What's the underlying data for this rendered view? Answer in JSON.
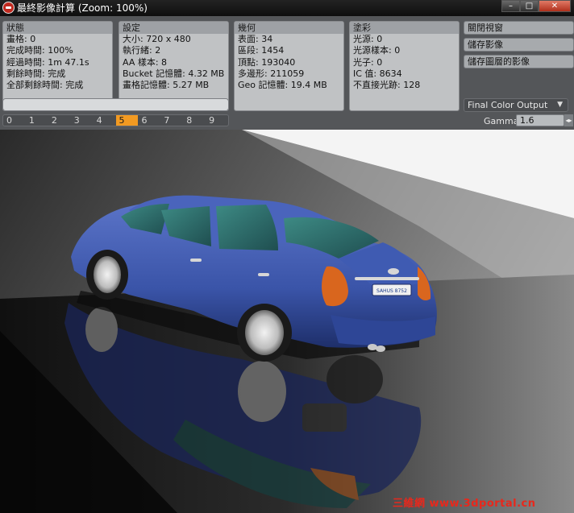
{
  "window": {
    "title": "最終影像計算 (Zoom: 100%)"
  },
  "status": {
    "header": "狀態",
    "rows": [
      "畫格: 0",
      "完成時間: 100%",
      "經過時間: 1m 47.1s",
      "剩餘時間: 完成",
      "全部剩餘時間: 完成"
    ]
  },
  "settings": {
    "header": "設定",
    "rows": [
      "大小: 720 x 480",
      "執行緒: 2",
      "AA 樣本: 8",
      "Bucket 記憶體: 4.32 MB",
      "畫格記憶體: 5.27 MB"
    ]
  },
  "geometry": {
    "header": "幾何",
    "rows": [
      "表面: 34",
      "區段: 1454",
      "頂點: 193040",
      "多邊形: 211059",
      "Geo 記憶體: 19.4 MB"
    ]
  },
  "shading": {
    "header": "塗彩",
    "rows": [
      "光源: 0",
      "光源樣本: 0",
      "光子: 0",
      "IC 值: 8634",
      "不直接光跡: 128"
    ]
  },
  "actions": {
    "close_window": "關閉視窗",
    "save_image": "儲存影像",
    "save_layered_image": "儲存圖層的影像"
  },
  "progress": {
    "fraction": 1.0
  },
  "buffers": {
    "items": [
      "0",
      "1",
      "2",
      "3",
      "4",
      "5",
      "6",
      "7",
      "8",
      "9"
    ],
    "active_index": 5
  },
  "output": {
    "selected": "Final Color Output"
  },
  "gamma": {
    "label": "Gamma",
    "value": "1.6"
  },
  "render": {
    "plate_text": "SAHUS 8752",
    "car_color": "#3a54a8",
    "taillight_color": "#d9661e"
  },
  "watermark": {
    "text": "三維網 www.3dportal.cn"
  }
}
